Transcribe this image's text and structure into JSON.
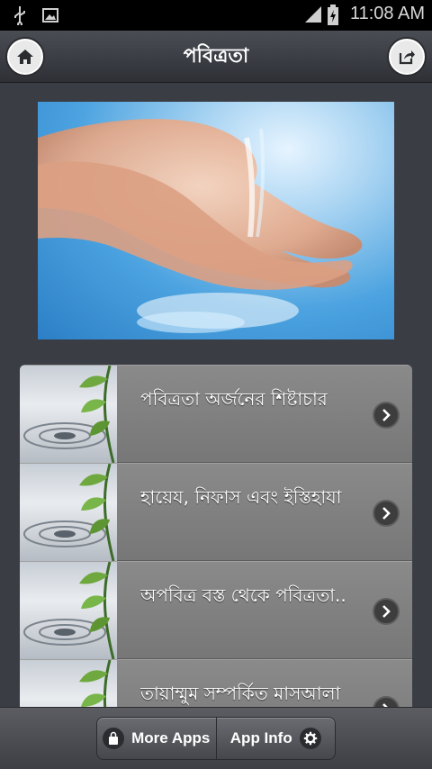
{
  "status_bar": {
    "time": "11:08 AM",
    "icons": [
      "usb-icon",
      "image-icon",
      "signal-icon",
      "battery-icon"
    ]
  },
  "header": {
    "title": "পবিত্রতা",
    "left_icon": "home-icon",
    "right_icon": "share-icon"
  },
  "hero": {
    "icon": "washing-hands-image"
  },
  "list": {
    "items": [
      {
        "label": "পবিত্রতা অর্জনের শিষ্টাচার"
      },
      {
        "label": "হায়েয, নিফাস এবং ইস্তিহাযা"
      },
      {
        "label": "অপবিত্র বস্ত থেকে পবিত্রতা.."
      },
      {
        "label": "তায়াম্মুম সম্পর্কিত মাসআলা"
      }
    ]
  },
  "bottom_bar": {
    "more_apps_label": "More Apps",
    "app_info_label": "App Info"
  }
}
